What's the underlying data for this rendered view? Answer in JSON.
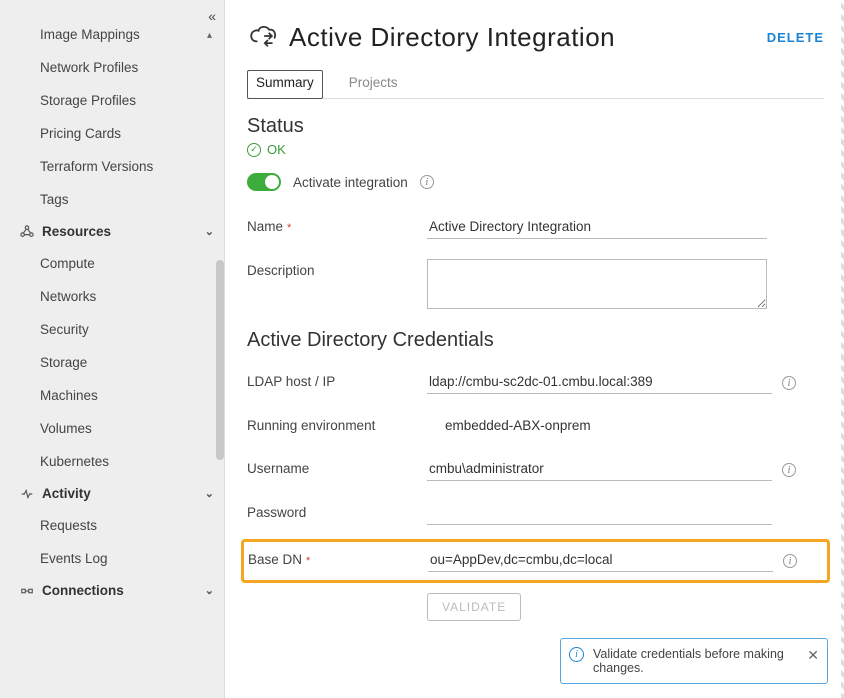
{
  "sidebar": {
    "top_items": [
      "Image Mappings",
      "Network Profiles",
      "Storage Profiles",
      "Pricing Cards",
      "Terraform Versions",
      "Tags"
    ],
    "sections": [
      {
        "icon": "resources",
        "label": "Resources",
        "items": [
          "Compute",
          "Networks",
          "Security",
          "Storage",
          "Machines",
          "Volumes",
          "Kubernetes"
        ]
      },
      {
        "icon": "activity",
        "label": "Activity",
        "items": [
          "Requests",
          "Events Log"
        ]
      },
      {
        "icon": "connections",
        "label": "Connections",
        "items": []
      }
    ]
  },
  "header": {
    "title": "Active Directory Integration",
    "delete": "DELETE"
  },
  "tabs": {
    "summary": "Summary",
    "projects": "Projects"
  },
  "status": {
    "heading": "Status",
    "text": "OK"
  },
  "toggle": {
    "label": "Activate integration"
  },
  "form": {
    "name_label": "Name",
    "name_value": "Active Directory Integration",
    "description_label": "Description",
    "description_value": "",
    "creds_heading": "Active Directory Credentials",
    "ldap_label": "LDAP host / IP",
    "ldap_value": "ldap://cmbu-sc2dc-01.cmbu.local:389",
    "runenv_label": "Running environment",
    "runenv_value": "embedded-ABX-onprem",
    "username_label": "Username",
    "username_value": "cmbu\\administrator",
    "password_label": "Password",
    "password_value": "",
    "basedn_label": "Base DN",
    "basedn_value": "ou=AppDev,dc=cmbu,dc=local",
    "validate_label": "VALIDATE"
  },
  "toast": {
    "text": "Validate credentials before making changes."
  }
}
